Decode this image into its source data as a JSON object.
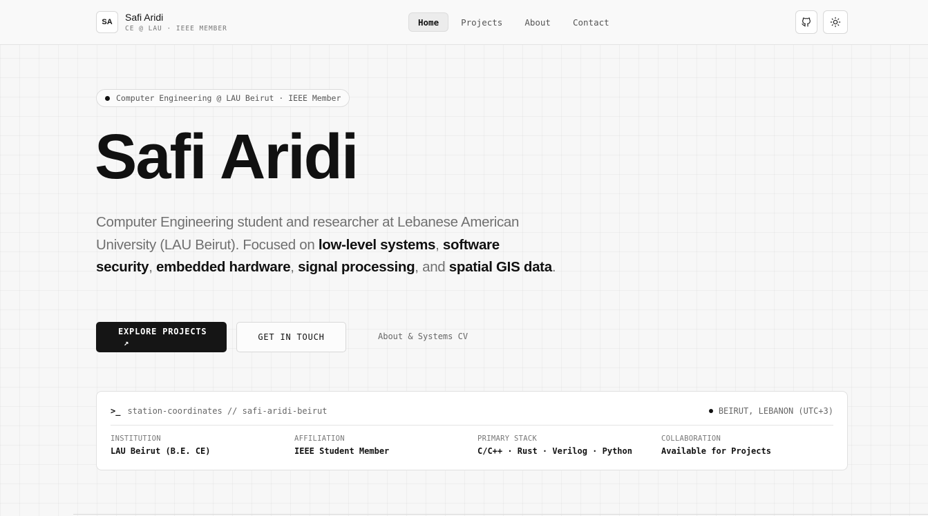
{
  "header": {
    "logo_initials": "SA",
    "name": "Safi Aridi",
    "subtitle": "CE @ LAU · IEEE MEMBER",
    "nav": [
      {
        "label": "Home",
        "active": true
      },
      {
        "label": "Projects",
        "active": false
      },
      {
        "label": "About",
        "active": false
      },
      {
        "label": "Contact",
        "active": false
      }
    ],
    "icons": [
      "github-icon",
      "sun-icon"
    ]
  },
  "hero": {
    "badge": "Computer Engineering @ LAU Beirut · IEEE Member",
    "title": "Safi Aridi",
    "description": {
      "intro": "Computer Engineering student and researcher at Lebanese American University (LAU Beirut). Focused on ",
      "focus_1": "low-level systems",
      "sep_1": ", ",
      "focus_2": "software security",
      "sep_2": ", ",
      "focus_3": "embedded hardware",
      "sep_3": ", ",
      "focus_4": "signal processing",
      "sep_4": ", and ",
      "focus_5": "spatial GIS data",
      "end": "."
    },
    "primary_button": "EXPLORE PROJECTS",
    "primary_button_icon": "↗",
    "secondary_button": "GET IN TOUCH",
    "link_button": "About & Systems CV"
  },
  "station": {
    "prompt": ">_",
    "title": "station-coordinates // safi-aridi-beirut",
    "location": "BEIRUT, LEBANON (UTC+3)",
    "fields": [
      {
        "key": "INSTITUTION",
        "value": "LAU Beirut (B.E. CE)"
      },
      {
        "key": "AFFILIATION",
        "value": "IEEE Student Member"
      },
      {
        "key": "PRIMARY STACK",
        "value": "C/C++ · Rust · Verilog · Python"
      },
      {
        "key": "COLLABORATION",
        "value": "Available for Projects"
      }
    ]
  },
  "colors": {
    "background": "#f7f7f7",
    "text": "#111111",
    "muted": "#707070",
    "primary_button": "#151515"
  }
}
